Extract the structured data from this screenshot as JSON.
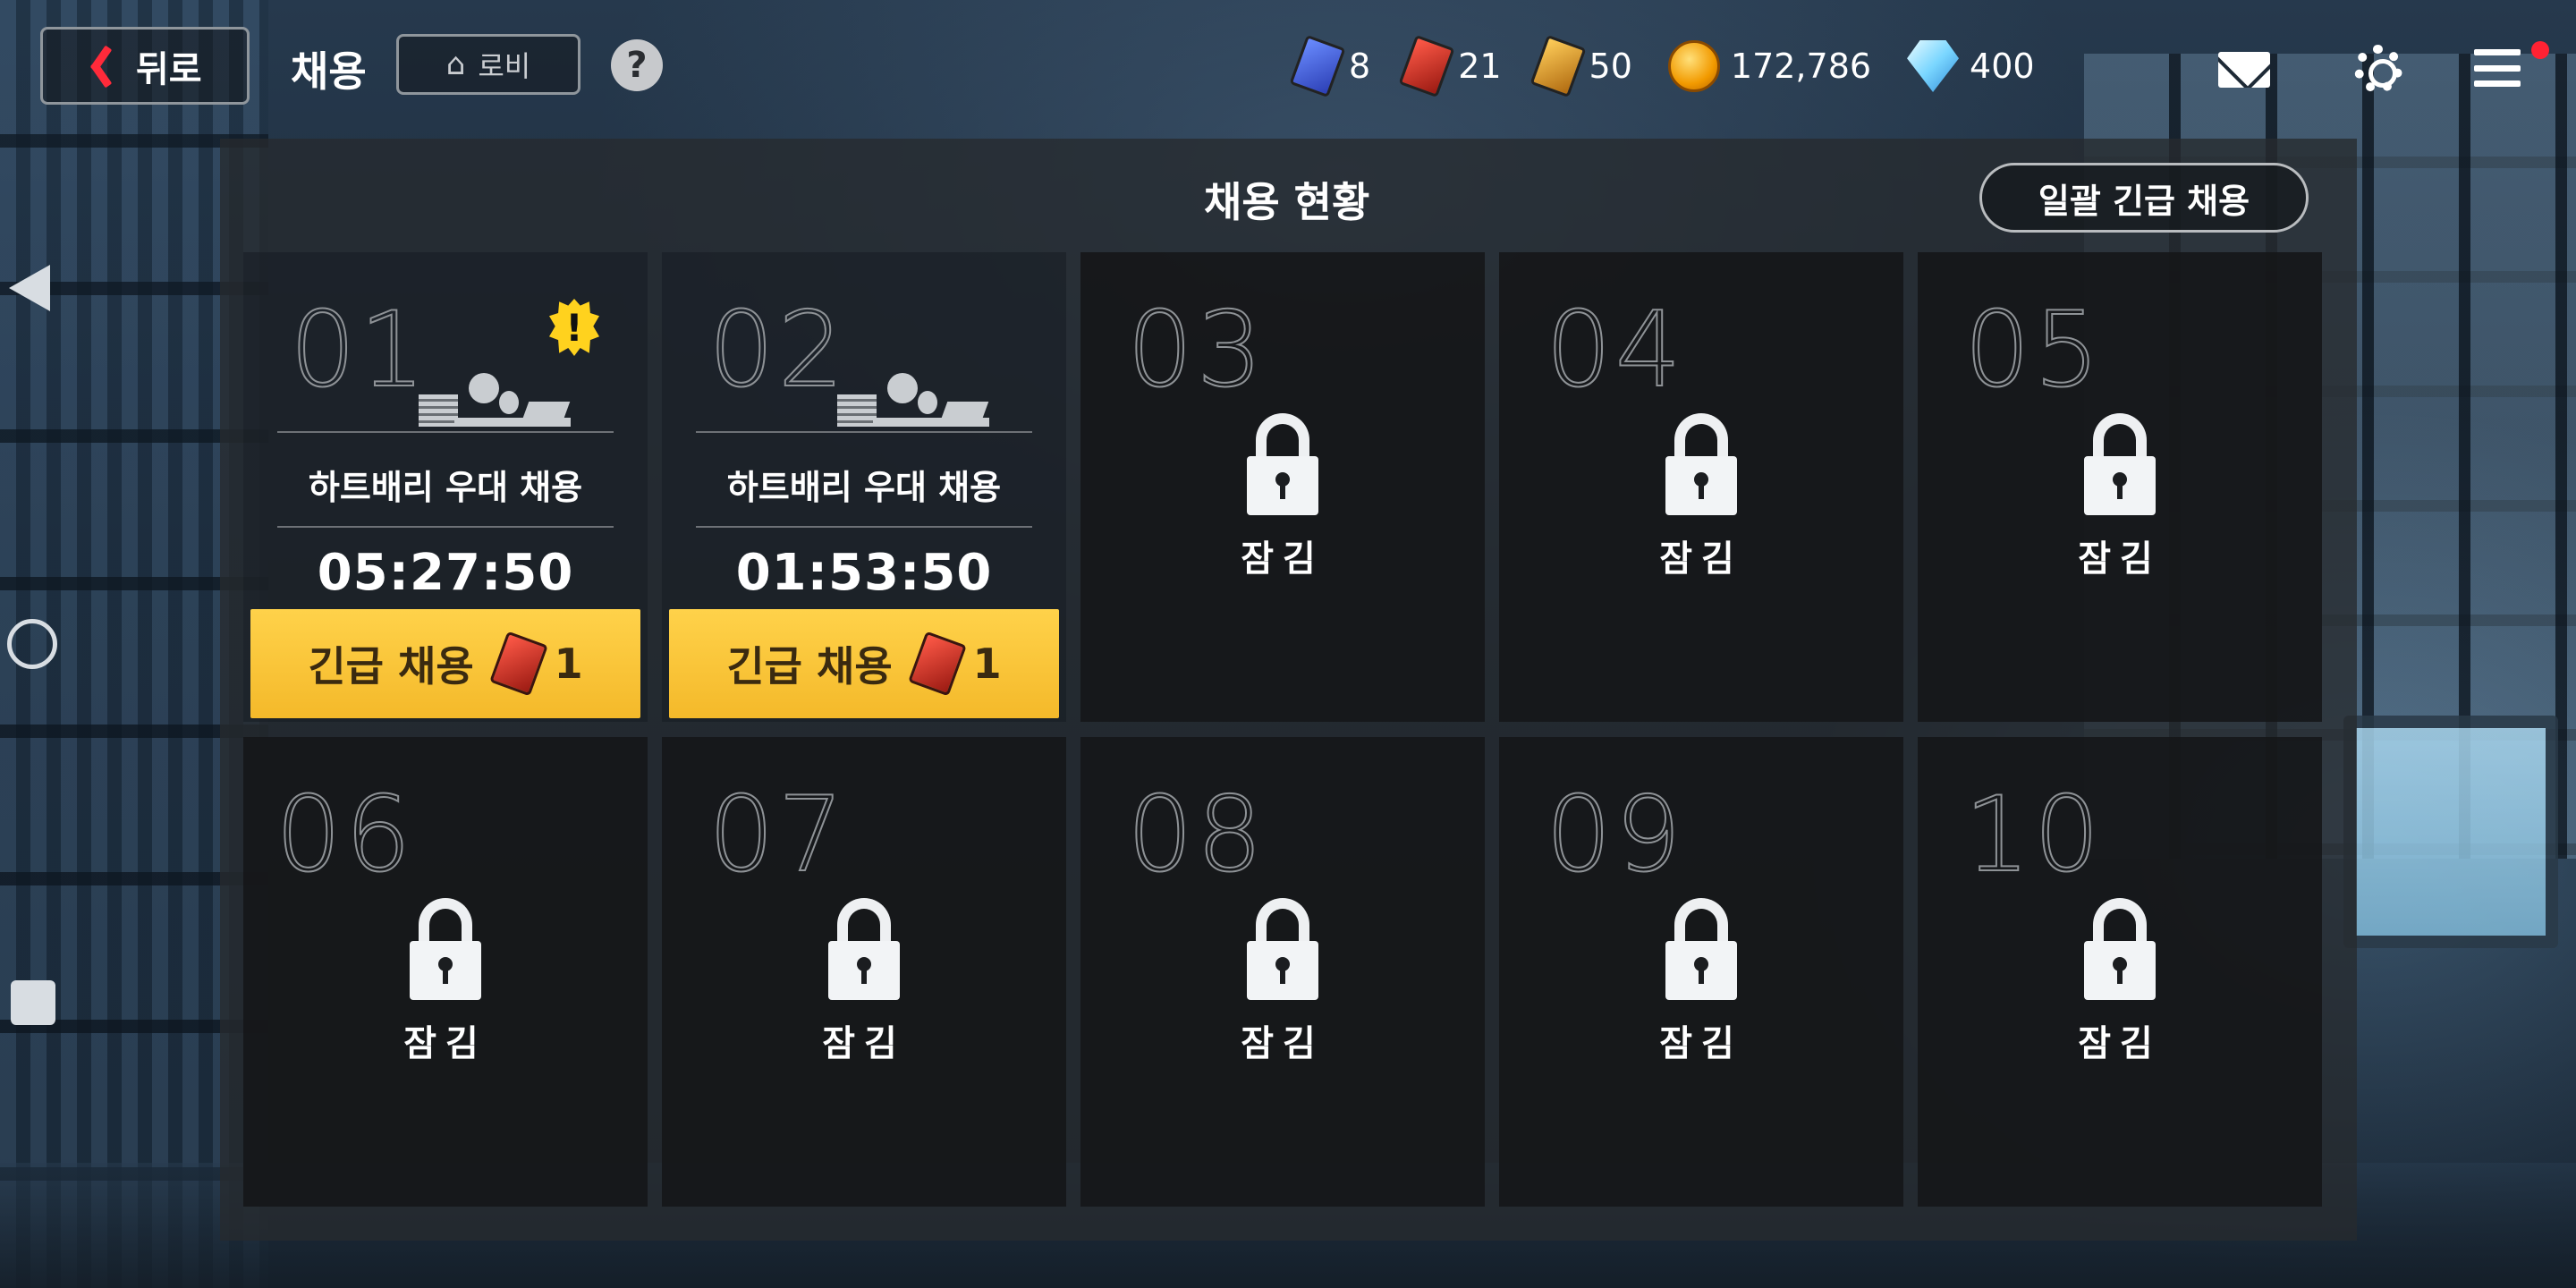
{
  "header": {
    "back_label": "뒤로",
    "title": "채용",
    "lobby_label": "로비",
    "help_label": "?"
  },
  "resources": [
    {
      "name": "blue-card",
      "value": "8"
    },
    {
      "name": "red-card",
      "value": "21"
    },
    {
      "name": "gold-card",
      "value": "50"
    },
    {
      "name": "gold-coin",
      "value": "172,786"
    },
    {
      "name": "diamond",
      "value": "400"
    }
  ],
  "panel": {
    "title": "채용 현황",
    "bulk_urgent_label": "일괄 긴급 채용"
  },
  "slots": [
    {
      "number": "01",
      "status": "active",
      "job": "하트배리 우대 채용",
      "timer": "05:27:50",
      "urgent_label": "긴급 채용",
      "cost": "1",
      "alert": "!"
    },
    {
      "number": "02",
      "status": "active",
      "job": "하트배리 우대 채용",
      "timer": "01:53:50",
      "urgent_label": "긴급 채용",
      "cost": "1"
    },
    {
      "number": "03",
      "status": "locked",
      "lock_label": "잠김"
    },
    {
      "number": "04",
      "status": "locked",
      "lock_label": "잠김"
    },
    {
      "number": "05",
      "status": "locked",
      "lock_label": "잠김"
    },
    {
      "number": "06",
      "status": "locked",
      "lock_label": "잠김"
    },
    {
      "number": "07",
      "status": "locked",
      "lock_label": "잠김"
    },
    {
      "number": "08",
      "status": "locked",
      "lock_label": "잠김"
    },
    {
      "number": "09",
      "status": "locked",
      "lock_label": "잠김"
    },
    {
      "number": "10",
      "status": "locked",
      "lock_label": "잠김"
    }
  ],
  "colors": {
    "accent_yellow": "#f4b92a",
    "back_chevron": "#ff2a3a",
    "notification_dot": "#ff2233"
  }
}
